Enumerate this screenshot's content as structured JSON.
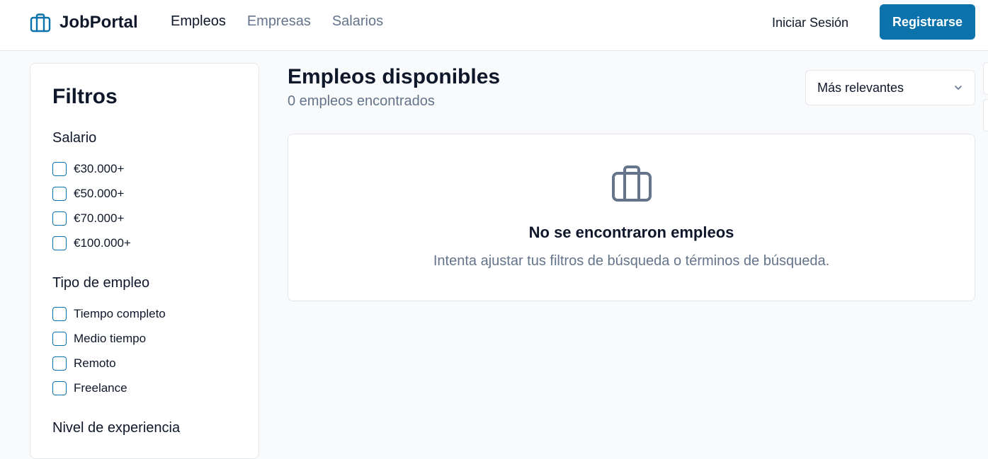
{
  "header": {
    "brand": "JobPortal",
    "nav": [
      "Empleos",
      "Empresas",
      "Salarios"
    ],
    "login": "Iniciar Sesión",
    "register": "Registrarse"
  },
  "filters": {
    "title": "Filtros",
    "salary": {
      "title": "Salario",
      "options": [
        "€30.000+",
        "€50.000+",
        "€70.000+",
        "€100.000+"
      ]
    },
    "job_type": {
      "title": "Tipo de empleo",
      "options": [
        "Tiempo completo",
        "Medio tiempo",
        "Remoto",
        "Freelance"
      ]
    },
    "experience": {
      "title": "Nivel de experiencia"
    }
  },
  "results": {
    "title": "Empleos disponibles",
    "count": "0 empleos encontrados",
    "sort": "Más relevantes",
    "empty_title": "No se encontraron empleos",
    "empty_desc": "Intenta ajustar tus filtros de búsqueda o términos de búsqueda."
  },
  "colors": {
    "accent": "#0b72ac",
    "text": "#0f172a",
    "muted": "#64748b",
    "background": "#f8fafc"
  },
  "icons": [
    "briefcase-icon",
    "chevron-down-icon"
  ]
}
